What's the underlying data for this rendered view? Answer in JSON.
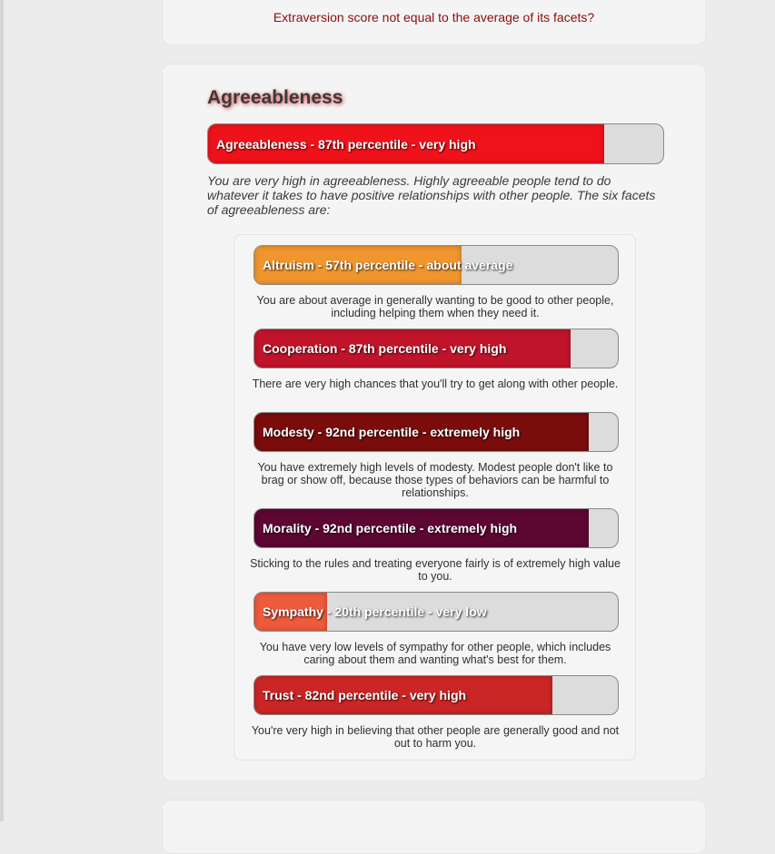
{
  "previous_section": {
    "note": "Extraversion score not equal to the average of its facets?"
  },
  "domain": {
    "title": "Agreeableness",
    "bar_label": "Agreeableness - 87th percentile - very high",
    "percentile": 87,
    "color": "#f0121a",
    "description": "You are very high in agreeableness. Highly agreeable people tend to do whatever it takes to have positive relationships with other people. The six facets of agreeableness are:"
  },
  "facets": [
    {
      "label": "Altruism - 57th percentile - about average",
      "percentile": 57,
      "color": "#f0962e",
      "description": "You are about average in generally wanting to be good to other people, including helping them when they need it."
    },
    {
      "label": "Cooperation - 87th percentile - very high",
      "percentile": 87,
      "color": "#c0142a",
      "description": "There are very high chances that you'll try to get along with other people."
    },
    {
      "label": "Modesty - 92nd percentile - extremely high",
      "percentile": 92,
      "color": "#7a0c0c",
      "description": "You have extremely high levels of modesty. Modest people don't like to brag or show off, because those types of behaviors can be harmful to relationships."
    },
    {
      "label": "Morality - 92nd percentile - extremely high",
      "percentile": 92,
      "color": "#5c0632",
      "description": "Sticking to the rules and treating everyone fairly is of extremely high value to you."
    },
    {
      "label": "Sympathy - 20th percentile - very low",
      "percentile": 20,
      "color": "#ee5a3c",
      "description": "You have very low levels of sympathy for other people, which includes caring about them and wanting what's best for them."
    },
    {
      "label": "Trust - 82nd percentile - very high",
      "percentile": 82,
      "color": "#cc2525",
      "description": "You're very high in believing that other people are generally good and not out to harm you."
    }
  ]
}
